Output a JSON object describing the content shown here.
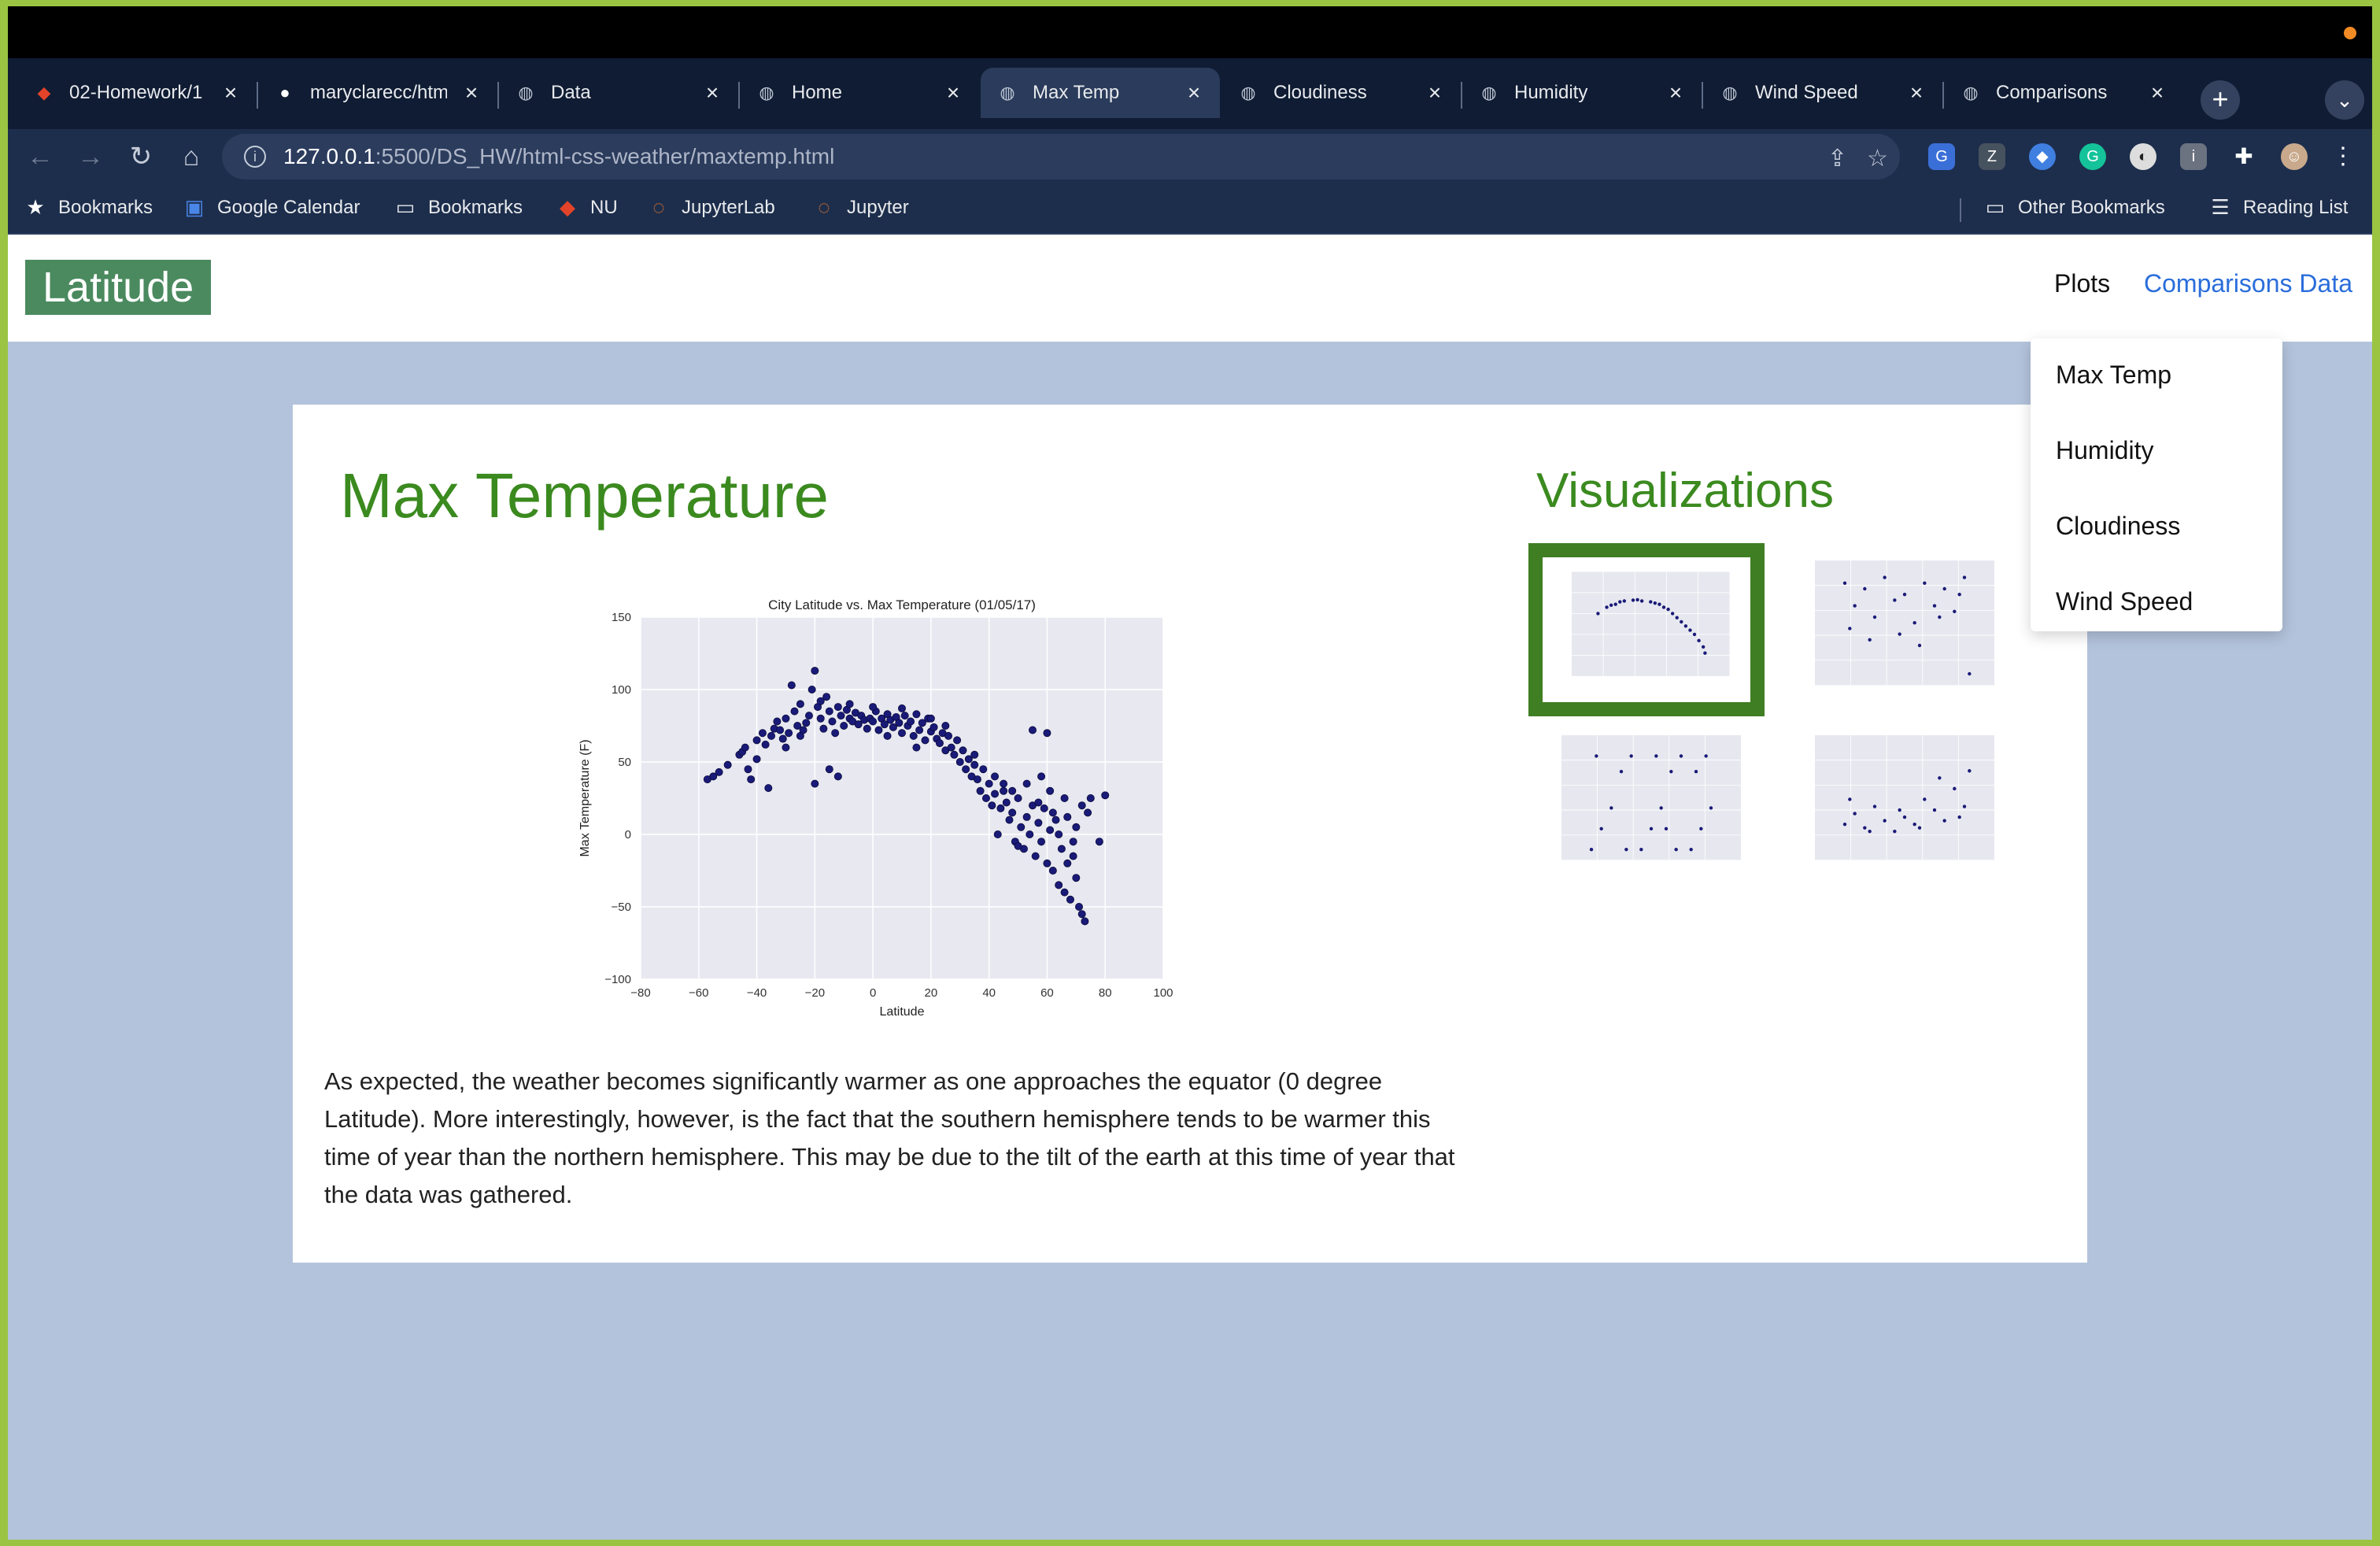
{
  "browser": {
    "tabs": [
      {
        "label": "02-Homework/1",
        "icon": "gitlab-icon"
      },
      {
        "label": "maryclarecc/htm",
        "icon": "github-icon"
      },
      {
        "label": "Data",
        "icon": "globe-icon"
      },
      {
        "label": "Home",
        "icon": "globe-icon"
      },
      {
        "label": "Max Temp",
        "icon": "globe-icon",
        "active": true
      },
      {
        "label": "Cloudiness",
        "icon": "globe-icon"
      },
      {
        "label": "Humidity",
        "icon": "globe-icon"
      },
      {
        "label": "Wind Speed",
        "icon": "globe-icon"
      },
      {
        "label": "Comparisons",
        "icon": "globe-icon"
      }
    ],
    "url_host": "127.0.0.1",
    "url_path": ":5500/DS_HW/html-css-weather/maxtemp.html",
    "bookmarks": [
      {
        "label": "Bookmarks",
        "icon": "star-icon"
      },
      {
        "label": "Google Calendar",
        "icon": "calendar-icon"
      },
      {
        "label": "Bookmarks",
        "icon": "folder-icon"
      },
      {
        "label": "NU",
        "icon": "gitlab-icon"
      },
      {
        "label": "JupyterLab",
        "icon": "jupyter-icon"
      },
      {
        "label": "Jupyter",
        "icon": "jupyter-icon"
      }
    ],
    "bookmarks_right": [
      {
        "label": "Other Bookmarks",
        "icon": "folder-icon"
      },
      {
        "label": "Reading List",
        "icon": "reading-list-icon"
      }
    ]
  },
  "site": {
    "brand": "Latitude",
    "nav": {
      "plots": "Plots",
      "comparisons": "Comparisons Data"
    },
    "dropdown": [
      "Max Temp",
      "Humidity",
      "Cloudiness",
      "Wind Speed"
    ]
  },
  "content": {
    "title": "Max Temperature",
    "description": "As expected, the weather becomes significantly warmer as one approaches the equator (0 degree Latitude). More interestingly, however, is the fact that the southern hemisphere tends to be warmer this time of year than the northern hemisphere. This may be due to the tilt of the earth at this time of year that the data was gathered.",
    "viz_title": "Visualizations"
  },
  "colors": {
    "accent_green": "#3b8a1f",
    "brand_bg": "#4b8a5f",
    "link_blue": "#2a6ddb",
    "page_bg": "#b3c3db",
    "marker": "#1a1a78"
  },
  "chart_data": {
    "type": "scatter",
    "title": "City Latitude vs. Max Temperature (01/05/17)",
    "xlabel": "Latitude",
    "ylabel": "Max Temperature (F)",
    "xlim": [
      -80,
      100
    ],
    "ylim": [
      -100,
      150
    ],
    "xticks": [
      -80,
      -60,
      -40,
      -20,
      0,
      20,
      40,
      60,
      80,
      100
    ],
    "yticks": [
      -100,
      -50,
      0,
      50,
      100,
      150
    ],
    "xtick_labels": [
      "−80",
      "−60",
      "−40",
      "−20",
      "0",
      "20",
      "40",
      "60",
      "80",
      "100"
    ],
    "ytick_labels": [
      "−100",
      "−50",
      "0",
      "50",
      "100",
      "150"
    ],
    "grid": true,
    "points": [
      [
        -55,
        40
      ],
      [
        -53,
        43
      ],
      [
        -50,
        48
      ],
      [
        -46,
        55
      ],
      [
        -45,
        57
      ],
      [
        -44,
        60
      ],
      [
        -43,
        45
      ],
      [
        -42,
        38
      ],
      [
        -40,
        65
      ],
      [
        -38,
        70
      ],
      [
        -37,
        62
      ],
      [
        -35,
        68
      ],
      [
        -34,
        73
      ],
      [
        -33,
        78
      ],
      [
        -32,
        72
      ],
      [
        -31,
        66
      ],
      [
        -30,
        80
      ],
      [
        -29,
        70
      ],
      [
        -28,
        103
      ],
      [
        -27,
        85
      ],
      [
        -26,
        75
      ],
      [
        -25,
        68
      ],
      [
        -24,
        72
      ],
      [
        -23,
        77
      ],
      [
        -22,
        82
      ],
      [
        -21,
        100
      ],
      [
        -20,
        113
      ],
      [
        -19,
        88
      ],
      [
        -18,
        80
      ],
      [
        -17,
        73
      ],
      [
        -16,
        95
      ],
      [
        -15,
        85
      ],
      [
        -14,
        78
      ],
      [
        -13,
        70
      ],
      [
        -12,
        88
      ],
      [
        -11,
        82
      ],
      [
        -10,
        75
      ],
      [
        -9,
        86
      ],
      [
        -8,
        80
      ],
      [
        -7,
        78
      ],
      [
        -6,
        84
      ],
      [
        -5,
        76
      ],
      [
        -4,
        82
      ],
      [
        -3,
        79
      ],
      [
        -2,
        73
      ],
      [
        -1,
        80
      ],
      [
        0,
        78
      ],
      [
        1,
        85
      ],
      [
        2,
        72
      ],
      [
        3,
        80
      ],
      [
        4,
        76
      ],
      [
        5,
        83
      ],
      [
        6,
        79
      ],
      [
        7,
        74
      ],
      [
        8,
        81
      ],
      [
        9,
        77
      ],
      [
        10,
        70
      ],
      [
        11,
        82
      ],
      [
        12,
        75
      ],
      [
        13,
        78
      ],
      [
        14,
        68
      ],
      [
        15,
        83
      ],
      [
        16,
        72
      ],
      [
        17,
        77
      ],
      [
        18,
        65
      ],
      [
        19,
        80
      ],
      [
        20,
        71
      ],
      [
        21,
        74
      ],
      [
        22,
        66
      ],
      [
        23,
        63
      ],
      [
        24,
        70
      ],
      [
        25,
        58
      ],
      [
        26,
        68
      ],
      [
        27,
        60
      ],
      [
        28,
        55
      ],
      [
        29,
        65
      ],
      [
        30,
        50
      ],
      [
        31,
        58
      ],
      [
        32,
        45
      ],
      [
        33,
        52
      ],
      [
        34,
        40
      ],
      [
        35,
        48
      ],
      [
        36,
        38
      ],
      [
        37,
        30
      ],
      [
        38,
        45
      ],
      [
        39,
        25
      ],
      [
        40,
        35
      ],
      [
        41,
        20
      ],
      [
        42,
        28
      ],
      [
        43,
        0
      ],
      [
        44,
        18
      ],
      [
        45,
        30
      ],
      [
        46,
        22
      ],
      [
        47,
        10
      ],
      [
        48,
        15
      ],
      [
        49,
        -5
      ],
      [
        50,
        25
      ],
      [
        51,
        5
      ],
      [
        52,
        -10
      ],
      [
        53,
        12
      ],
      [
        54,
        0
      ],
      [
        55,
        20
      ],
      [
        56,
        -15
      ],
      [
        57,
        8
      ],
      [
        58,
        -5
      ],
      [
        59,
        18
      ],
      [
        60,
        -20
      ],
      [
        61,
        3
      ],
      [
        62,
        -25
      ],
      [
        63,
        10
      ],
      [
        64,
        -35
      ],
      [
        65,
        -10
      ],
      [
        66,
        -40
      ],
      [
        67,
        -20
      ],
      [
        68,
        -45
      ],
      [
        69,
        -5
      ],
      [
        70,
        -30
      ],
      [
        71,
        -50
      ],
      [
        72,
        -55
      ],
      [
        73,
        -60
      ],
      [
        74,
        15
      ],
      [
        75,
        25
      ],
      [
        78,
        -5
      ],
      [
        80,
        27
      ],
      [
        -57,
        38
      ],
      [
        -20,
        35
      ],
      [
        -36,
        32
      ],
      [
        -15,
        45
      ],
      [
        -12,
        40
      ],
      [
        55,
        72
      ],
      [
        58,
        40
      ],
      [
        60,
        70
      ],
      [
        45,
        35
      ],
      [
        50,
        -8
      ],
      [
        62,
        15
      ],
      [
        66,
        25
      ],
      [
        70,
        5
      ],
      [
        72,
        20
      ],
      [
        0,
        88
      ],
      [
        -25,
        90
      ],
      [
        -18,
        92
      ],
      [
        10,
        87
      ],
      [
        20,
        80
      ],
      [
        -40,
        52
      ],
      [
        -30,
        60
      ],
      [
        -8,
        90
      ],
      [
        5,
        68
      ],
      [
        15,
        60
      ],
      [
        25,
        75
      ],
      [
        35,
        55
      ],
      [
        42,
        40
      ],
      [
        48,
        30
      ],
      [
        53,
        35
      ],
      [
        57,
        22
      ],
      [
        61,
        30
      ],
      [
        64,
        0
      ],
      [
        67,
        12
      ],
      [
        69,
        -15
      ]
    ]
  },
  "thumbnails": [
    {
      "name": "maxtemp",
      "selected": true,
      "points": [
        [
          -50,
          50
        ],
        [
          -40,
          65
        ],
        [
          -30,
          72
        ],
        [
          -20,
          80
        ],
        [
          -10,
          82
        ],
        [
          0,
          80
        ],
        [
          10,
          78
        ],
        [
          20,
          72
        ],
        [
          30,
          60
        ],
        [
          40,
          40
        ],
        [
          50,
          20
        ],
        [
          60,
          0
        ],
        [
          70,
          -30
        ],
        [
          -35,
          70
        ],
        [
          -25,
          78
        ],
        [
          -5,
          83
        ],
        [
          15,
          75
        ],
        [
          25,
          65
        ],
        [
          35,
          50
        ],
        [
          45,
          30
        ],
        [
          55,
          10
        ],
        [
          65,
          -15
        ],
        [
          72,
          -45
        ]
      ]
    },
    {
      "name": "humidity",
      "selected": false,
      "points": [
        [
          -50,
          90
        ],
        [
          -40,
          70
        ],
        [
          -30,
          85
        ],
        [
          -20,
          60
        ],
        [
          -10,
          95
        ],
        [
          0,
          75
        ],
        [
          10,
          80
        ],
        [
          20,
          55
        ],
        [
          30,
          90
        ],
        [
          40,
          70
        ],
        [
          50,
          85
        ],
        [
          60,
          65
        ],
        [
          70,
          95
        ],
        [
          -45,
          50
        ],
        [
          -25,
          40
        ],
        [
          5,
          45
        ],
        [
          25,
          35
        ],
        [
          45,
          60
        ],
        [
          65,
          80
        ],
        [
          75,
          10
        ]
      ]
    },
    {
      "name": "cloudiness",
      "selected": false,
      "points": [
        [
          -50,
          0
        ],
        [
          -40,
          20
        ],
        [
          -30,
          40
        ],
        [
          -20,
          75
        ],
        [
          -10,
          90
        ],
        [
          0,
          0
        ],
        [
          10,
          20
        ],
        [
          20,
          40
        ],
        [
          30,
          75
        ],
        [
          40,
          90
        ],
        [
          50,
          0
        ],
        [
          60,
          20
        ],
        [
          70,
          40
        ],
        [
          -45,
          90
        ],
        [
          -15,
          0
        ],
        [
          15,
          90
        ],
        [
          35,
          0
        ],
        [
          55,
          75
        ],
        [
          65,
          90
        ],
        [
          25,
          20
        ]
      ]
    },
    {
      "name": "windspeed",
      "selected": false,
      "points": [
        [
          -50,
          5
        ],
        [
          -40,
          8
        ],
        [
          -30,
          4
        ],
        [
          -20,
          10
        ],
        [
          -10,
          6
        ],
        [
          0,
          3
        ],
        [
          10,
          7
        ],
        [
          20,
          5
        ],
        [
          30,
          12
        ],
        [
          40,
          9
        ],
        [
          50,
          6
        ],
        [
          60,
          15
        ],
        [
          70,
          10
        ],
        [
          -45,
          12
        ],
        [
          -25,
          3
        ],
        [
          5,
          9
        ],
        [
          25,
          4
        ],
        [
          45,
          18
        ],
        [
          65,
          7
        ],
        [
          75,
          20
        ]
      ]
    }
  ]
}
